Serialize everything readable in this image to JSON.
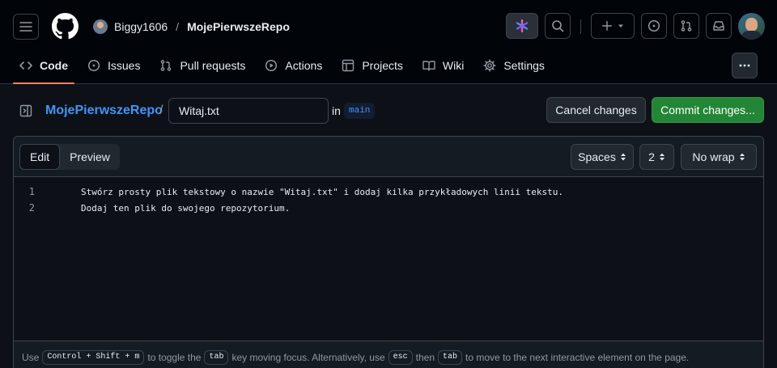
{
  "header": {
    "owner": "Biggy1606",
    "separator": "/",
    "repo": "MojePierwszeRepo"
  },
  "tabs": [
    {
      "label": "Code",
      "icon": "code-icon",
      "active": true
    },
    {
      "label": "Issues",
      "icon": "issue-circle-icon"
    },
    {
      "label": "Pull requests",
      "icon": "pull-request-icon"
    },
    {
      "label": "Actions",
      "icon": "play-icon"
    },
    {
      "label": "Projects",
      "icon": "table-icon"
    },
    {
      "label": "Wiki",
      "icon": "book-icon"
    },
    {
      "label": "Settings",
      "icon": "gear-icon"
    }
  ],
  "toolbar": {
    "repo_link": "MojePierwszeRepo",
    "path_sep": "/",
    "filename": "Witaj.txt",
    "in_label": "in",
    "branch": "main",
    "cancel": "Cancel changes",
    "commit": "Commit changes..."
  },
  "editor": {
    "tab_edit": "Edit",
    "tab_preview": "Preview",
    "indent_mode": "Spaces",
    "indent_size": "2",
    "wrap_mode": "No wrap",
    "lines": [
      {
        "num": "1",
        "text": "Stwórz prosty plik tekstowy o nazwie \"Witaj.txt\" i dodaj kilka przykładowych linii tekstu."
      },
      {
        "num": "2",
        "text": "Dodaj ten plik do swojego repozytorium."
      }
    ]
  },
  "footer": {
    "t1": "Use",
    "k1": "Control + Shift + m",
    "t2": "to toggle the",
    "k2": "tab",
    "t3": "key moving focus. Alternatively, use",
    "k3": "esc",
    "t4": "then",
    "k4": "tab",
    "t5": "to move to the next interactive element on the page."
  },
  "colors": {
    "accent_blue": "#4493f8",
    "commit_green": "#238636",
    "active_tab_underline": "#f78166"
  }
}
